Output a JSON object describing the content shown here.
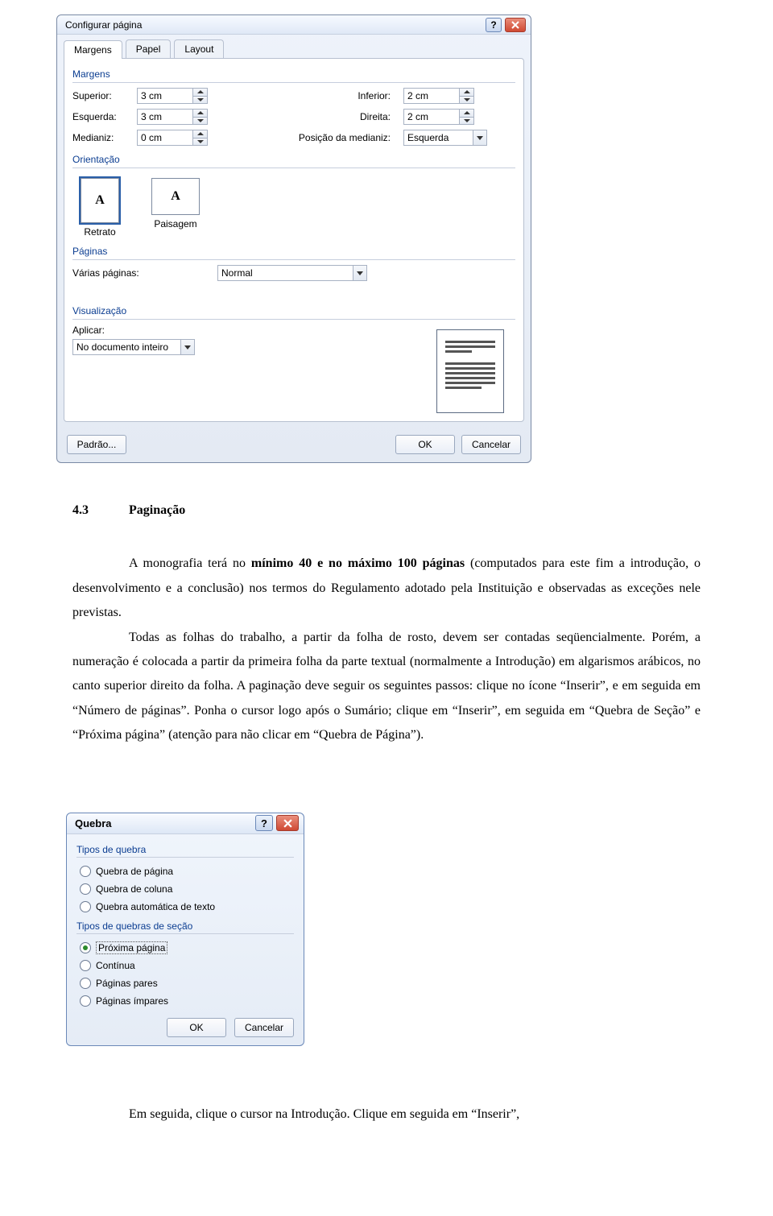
{
  "dialog1": {
    "title": "Configurar página",
    "tabs": [
      "Margens",
      "Papel",
      "Layout"
    ],
    "margens": {
      "title": "Margens",
      "superior": {
        "label": "Superior:",
        "value": "3 cm"
      },
      "inferior": {
        "label": "Inferior:",
        "value": "2 cm"
      },
      "esquerda": {
        "label": "Esquerda:",
        "value": "3 cm"
      },
      "direita": {
        "label": "Direita:",
        "value": "2 cm"
      },
      "medianiz": {
        "label": "Medianiz:",
        "value": "0 cm"
      },
      "posmed": {
        "label": "Posição da medianiz:",
        "value": "Esquerda"
      }
    },
    "orient": {
      "title": "Orientação",
      "retrato": "Retrato",
      "paisagem": "Paisagem"
    },
    "paginas": {
      "title": "Páginas",
      "varias": "Várias páginas:",
      "value": "Normal"
    },
    "visual": {
      "title": "Visualização",
      "aplicar": "Aplicar:",
      "value": "No documento inteiro"
    },
    "buttons": {
      "padrao": "Padrão...",
      "ok": "OK",
      "cancelar": "Cancelar"
    }
  },
  "doc": {
    "secnum": "4.3",
    "sectitle": "Paginação",
    "p1": "A monografia terá no mínimo 40 e no máximo 100 páginas (computados para este fim a introdução, o desenvolvimento e a conclusão) nos termos do Regulamento adotado pela Instituição e observadas as exceções nele previstas.",
    "p2": "Todas as folhas do trabalho, a partir da folha de rosto, devem ser contadas seqüencialmente. Porém, a numeração é colocada a partir da primeira folha da parte textual (normalmente a Introdução) em algarismos arábicos, no canto superior direito da folha. A paginação deve seguir os seguintes passos: clique no ícone “Inserir”, e em seguida em “Número de páginas”. Ponha o cursor logo após o Sumário; clique em “Inserir”, em seguida em “Quebra de Seção” e “Próxima página” (atenção para não clicar em “Quebra de Página”)."
  },
  "dialog2": {
    "title": "Quebra",
    "tipos": "Tipos de quebra",
    "r_pagina": "Quebra de página",
    "r_coluna": "Quebra de coluna",
    "r_auto": "Quebra automática de texto",
    "tipos2": "Tipos de quebras de seção",
    "r_prox": "Próxima página",
    "r_cont": "Contínua",
    "r_pares": "Páginas pares",
    "r_imp": "Páginas ímpares",
    "ok": "OK",
    "cancelar": "Cancelar"
  },
  "footer": {
    "p": "Em seguida, clique o cursor na Introdução. Clique em seguida em “Inserir”,"
  }
}
